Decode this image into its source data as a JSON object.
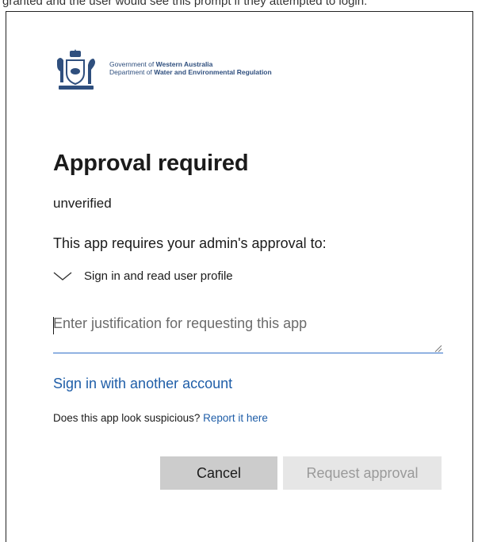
{
  "caption": "granted and the user would see this prompt if they attempted to login:",
  "logo": {
    "line1_prefix": "Government of ",
    "line1_bold": "Western Australia",
    "line2_prefix": "Department of ",
    "line2_bold": "Water and Environmental Regulation"
  },
  "dialog": {
    "title": "Approval required",
    "subtitle": "unverified",
    "requires_text": "This app requires your admin's approval to:",
    "permissions": [
      {
        "label": "Sign in and read user profile"
      }
    ],
    "justification_placeholder": "Enter justification for requesting this app",
    "another_account": "Sign in with another account",
    "suspicious_text": "Does this app look suspicious? ",
    "report_link": "Report it here",
    "cancel_label": "Cancel",
    "request_label": "Request approval"
  },
  "colors": {
    "link": "#1f5ea8",
    "cancel_bg": "#cccccc",
    "request_bg": "#e6e6e6",
    "input_underline": "#2f6ec8"
  }
}
